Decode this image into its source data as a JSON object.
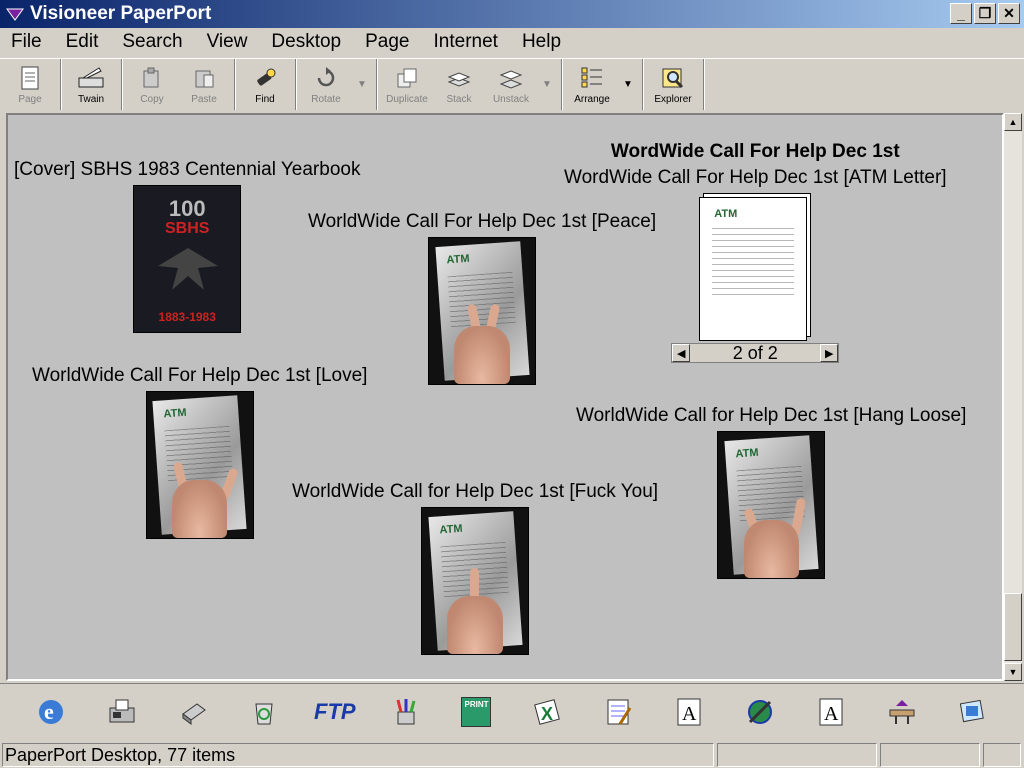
{
  "window": {
    "title": "Visioneer PaperPort",
    "minimize": "_",
    "restore": "❐",
    "close": "✕"
  },
  "menu": [
    "File",
    "Edit",
    "Search",
    "View",
    "Desktop",
    "Page",
    "Internet",
    "Help"
  ],
  "toolbar": {
    "page": "Page",
    "twain": "Twain",
    "copy": "Copy",
    "paste": "Paste",
    "find": "Find",
    "rotate": "Rotate",
    "duplicate": "Duplicate",
    "stack": "Stack",
    "unstack": "Unstack",
    "arrange": "Arrange",
    "explorer": "Explorer"
  },
  "desktop": {
    "items": [
      {
        "title": "[Cover] SBHS 1983 Centennial Yearbook",
        "cover_top": "100",
        "cover_mid": "SBHS",
        "cover_years": "1883-1983"
      },
      {
        "title": "WorldWide Call For Help Dec 1st [Peace]"
      },
      {
        "heading": "WordWide Call For Help Dec 1st",
        "title": "WordWide Call For Help Dec 1st [ATM Letter]",
        "pager": "2 of 2"
      },
      {
        "title": "WorldWide Call For Help Dec 1st [Love]"
      },
      {
        "title": "WorldWide Call for Help Dec 1st [Hang Loose]"
      },
      {
        "title": "WorldWide Call for Help Dec 1st [Fuck You]"
      }
    ],
    "atm_logo": "ATM"
  },
  "launchbar": {
    "ftp": "FTP",
    "print": "PRINT",
    "icons": [
      "internet-explorer-icon",
      "fax-icon",
      "printer-icon",
      "recycle-icon",
      "ftp-icon",
      "paint-icon",
      "print-shop-icon",
      "excel-icon",
      "notepad-icon",
      "text-doc-icon",
      "netscape-icon",
      "word-doc-icon",
      "inbox-icon",
      "scan-to-app-icon"
    ]
  },
  "status": {
    "text": "PaperPort Desktop, 77 items"
  }
}
